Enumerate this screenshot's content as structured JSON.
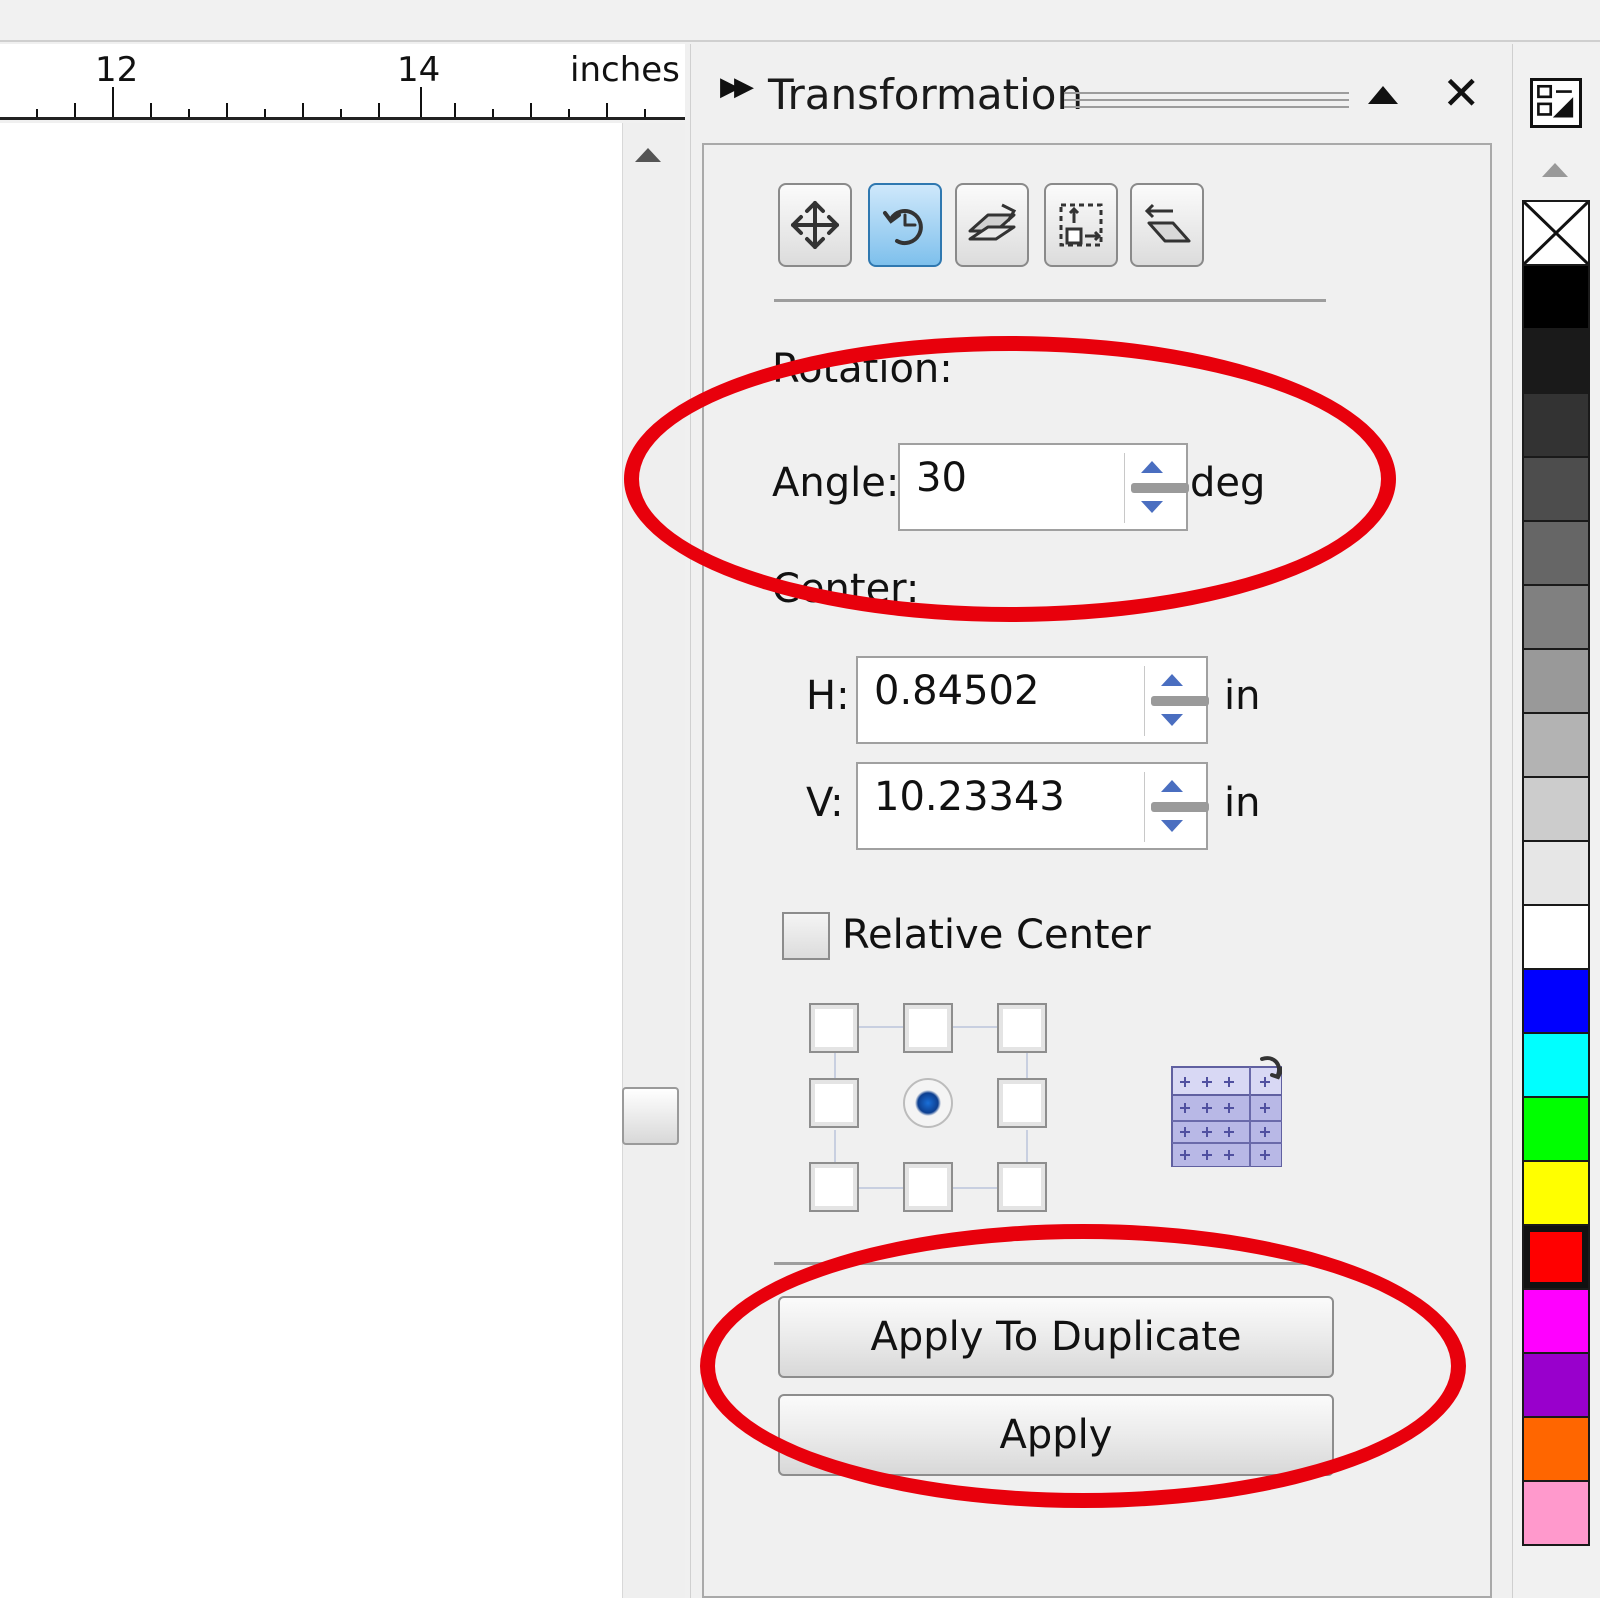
{
  "ruler": {
    "labels": [
      "12",
      "14",
      "inches"
    ]
  },
  "docker": {
    "title": "Transformation",
    "expand_icon": "double-chevron-right-icon",
    "close_glyph": "✕"
  },
  "modes": [
    {
      "name": "position",
      "icon": "move-arrows-icon",
      "active": false
    },
    {
      "name": "rotate",
      "icon": "rotate-icon",
      "active": true
    },
    {
      "name": "scale-mirror",
      "icon": "mirror-icon",
      "active": false
    },
    {
      "name": "size",
      "icon": "size-icon",
      "active": false
    },
    {
      "name": "skew",
      "icon": "skew-icon",
      "active": false
    }
  ],
  "rotation": {
    "section_label": "Rotation:",
    "angle_label": "Angle:",
    "angle_value": "30",
    "angle_unit": "deg"
  },
  "center": {
    "section_label": "Center:",
    "h_label": "H:",
    "h_value": "0.84502",
    "h_unit": "in",
    "v_label": "V:",
    "v_value": "10.23343",
    "v_unit": "in"
  },
  "relative_center": {
    "label": "Relative Center",
    "checked": false
  },
  "anchor": {
    "selected": "middle-center"
  },
  "buttons": {
    "apply_duplicate": "Apply To Duplicate",
    "apply": "Apply"
  },
  "highlights": {
    "color": "#e8000c"
  },
  "palette": {
    "colors": [
      "none",
      "#000000",
      "#1a1a1a",
      "#333333",
      "#4d4d4d",
      "#666666",
      "#808080",
      "#999999",
      "#b3b3b3",
      "#cccccc",
      "#e6e6e6",
      "#ffffff",
      "#0000ff",
      "#00ffff",
      "#00ff00",
      "#ffff00",
      "#ff0000",
      "#ff00ff",
      "#9900cc",
      "#ff6600",
      "#ff99cc"
    ]
  }
}
